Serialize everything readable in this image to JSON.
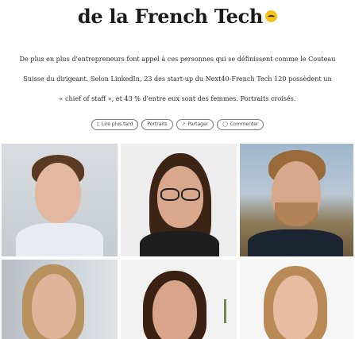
{
  "article": {
    "headline": "de la French Tech",
    "headline_emoji": "grinning-face-emoji",
    "lede_lines": [
      "De plus en plus d'entrepreneurs font appel à ces personnes qui se définissent comme le Couteau",
      "Suisse du dirigeant. Selon LinkedIn, 23 des start-up du Next40-French Tech 120 possèdent un",
      "« chief of staff », et 43 % d'entre eux sont des femmes. Portraits croisés."
    ]
  },
  "actions": {
    "read_later": "Lire plus tard",
    "portraits": "Portraits",
    "share": "Partager",
    "comment": "Commenter"
  },
  "icons": {
    "read_later": "bookmark-icon",
    "share": "share-icon",
    "comment": "comment-icon"
  },
  "photos": [
    {
      "subject": "man-short-hair",
      "color_accent": "#e2b9a0"
    },
    {
      "subject": "woman-glasses",
      "color_accent": "#d9a88c"
    },
    {
      "subject": "man-beard",
      "color_accent": "#d8a88a"
    },
    {
      "subject": "woman-blond",
      "color_accent": "#e0b49a"
    },
    {
      "subject": "woman-dark-hair",
      "color_accent": "#d9a58a"
    },
    {
      "subject": "woman-light-hair",
      "color_accent": "#e6bca3"
    }
  ]
}
